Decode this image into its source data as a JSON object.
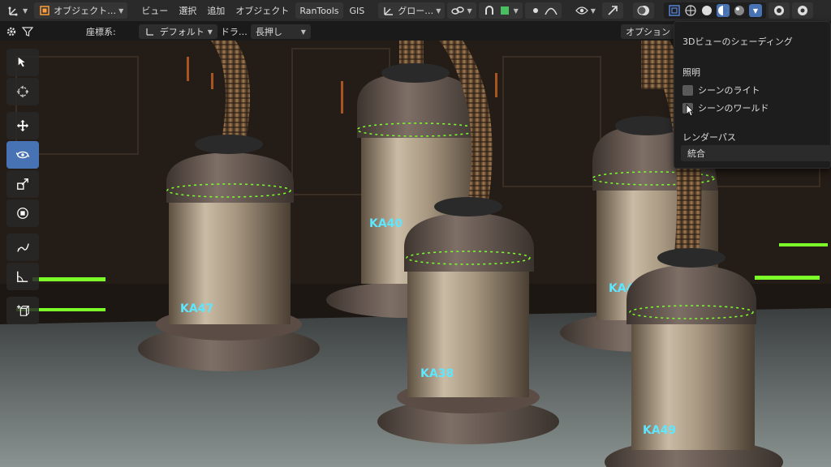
{
  "header": {
    "mode_label": "オブジェクト…",
    "menus": [
      "ビュー",
      "選択",
      "追加",
      "オブジェクト",
      "RanTools",
      "GIS"
    ],
    "orientation_label": "グロー…"
  },
  "toolrow": {
    "coordinate_label": "座標系:",
    "coordinate_value": "デフォルト",
    "drag_label": "ドラ…",
    "drag_value": "長押し",
    "options_label": "オプション"
  },
  "popover": {
    "title": "3Dビューのシェーディング",
    "lighting_label": "照明",
    "scene_lights_label": "シーンのライト",
    "scene_world_label": "シーンのワールド",
    "render_pass_label": "レンダーパス",
    "render_pass_value": "統合"
  },
  "scene": {
    "labels": [
      "KA47",
      "KA40",
      "KA38",
      "KA44",
      "KA49"
    ]
  },
  "colors": {
    "accent": "#4772b3",
    "glow": "#7dff2a",
    "label_glow": "#5fe6ff"
  }
}
